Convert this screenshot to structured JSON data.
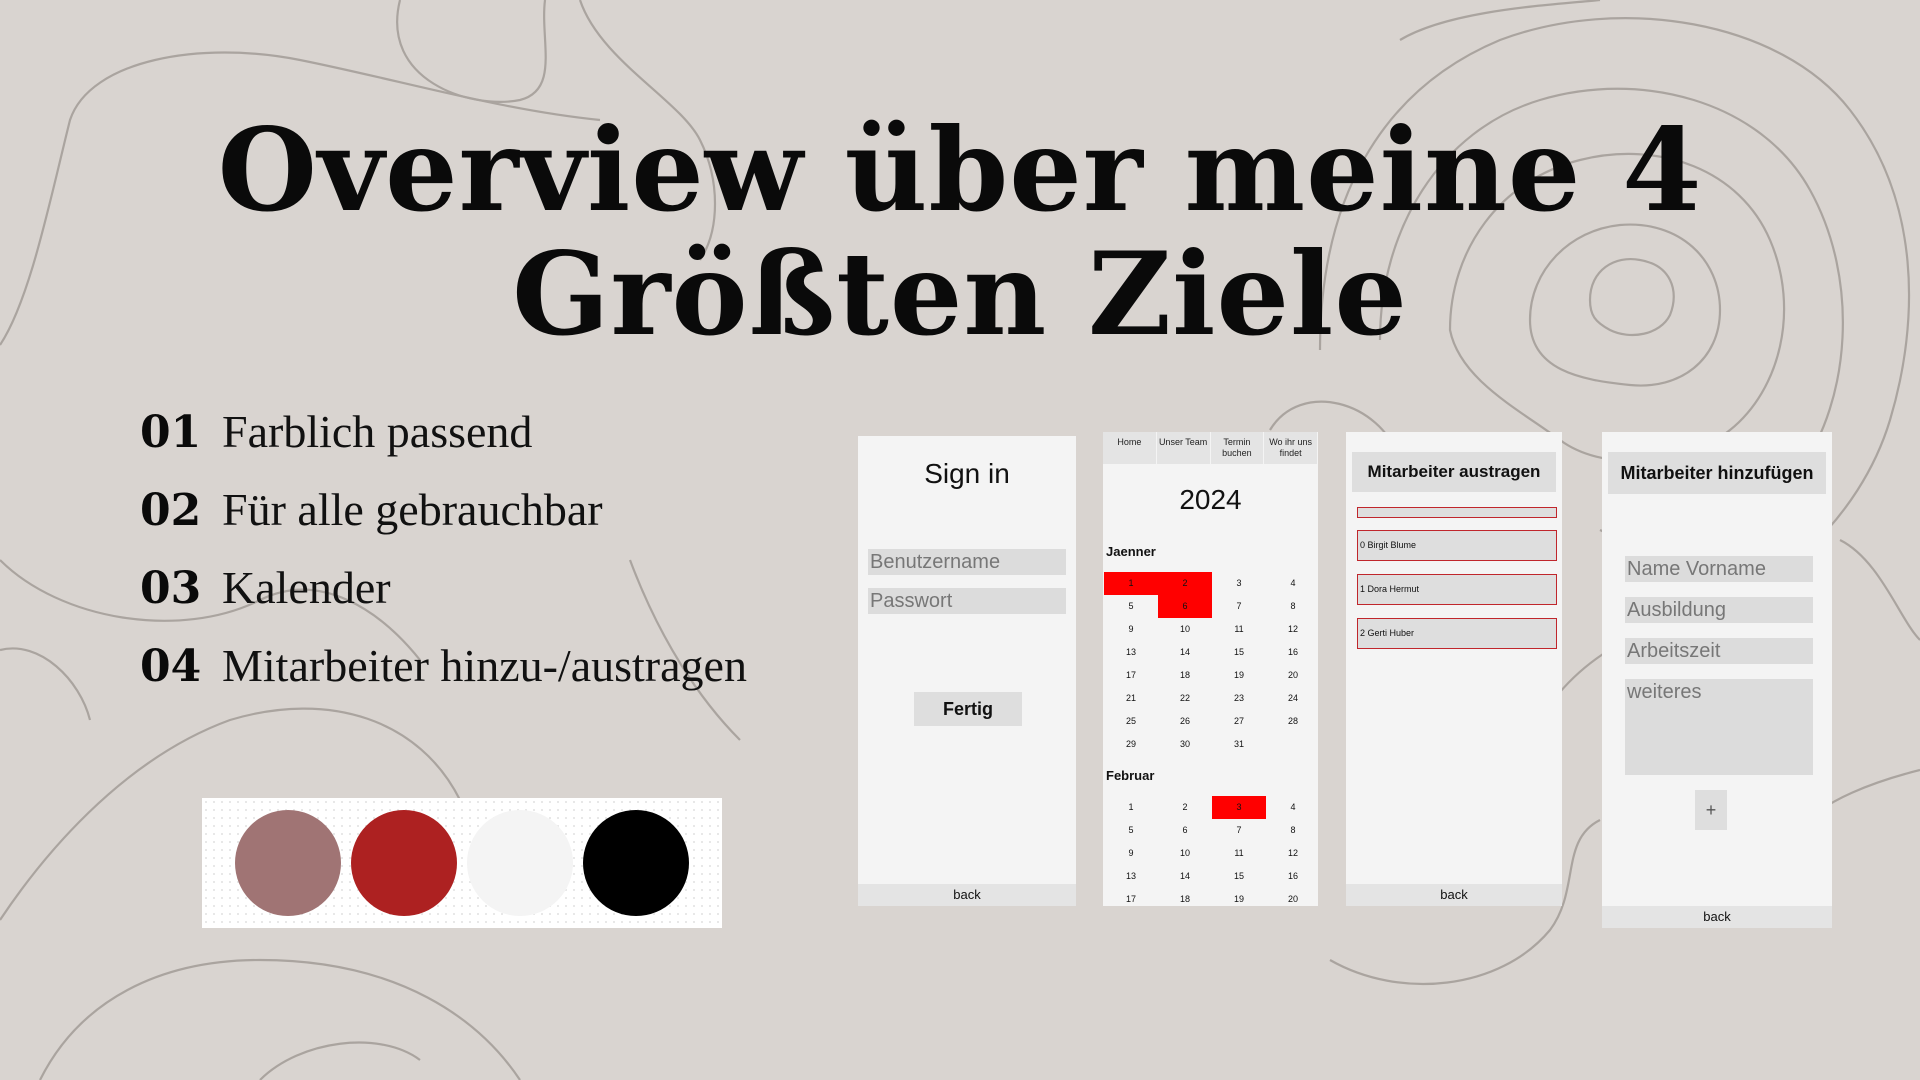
{
  "title": "Overview über meine 4 Größten Ziele",
  "goals": [
    {
      "num": "01",
      "text": "Farblich passend"
    },
    {
      "num": "02",
      "text": "Für alle gebrauchbar"
    },
    {
      "num": "03",
      "text": "Kalender"
    },
    {
      "num": "04",
      "text": "Mitarbeiter hinzu-/austragen"
    }
  ],
  "palette": [
    "#a07474",
    "#ad2121",
    "#f4f4f4",
    "#000000"
  ],
  "signin": {
    "title": "Sign in",
    "username_placeholder": "Benutzername",
    "password_placeholder": "Passwort",
    "submit": "Fertig",
    "back": "back"
  },
  "calendar": {
    "nav": [
      "Home",
      "Unser Team",
      "Termin buchen",
      "Wo ihr uns findet"
    ],
    "year": "2024",
    "months": [
      {
        "name": "Jaenner",
        "days": [
          [
            "1",
            "2",
            "3",
            "4"
          ],
          [
            "5",
            "6",
            "7",
            "8"
          ],
          [
            "9",
            "10",
            "11",
            "12"
          ],
          [
            "13",
            "14",
            "15",
            "16"
          ],
          [
            "17",
            "18",
            "19",
            "20"
          ],
          [
            "21",
            "22",
            "23",
            "24"
          ],
          [
            "25",
            "26",
            "27",
            "28"
          ],
          [
            "29",
            "30",
            "31",
            ""
          ]
        ],
        "highlighted": [
          "1",
          "2",
          "6"
        ]
      },
      {
        "name": "Februar",
        "days": [
          [
            "1",
            "2",
            "3",
            "4"
          ],
          [
            "5",
            "6",
            "7",
            "8"
          ],
          [
            "9",
            "10",
            "11",
            "12"
          ],
          [
            "13",
            "14",
            "15",
            "16"
          ],
          [
            "17",
            "18",
            "19",
            "20"
          ]
        ],
        "highlighted": [
          "3"
        ]
      }
    ]
  },
  "remove": {
    "title": "Mitarbeiter austragen",
    "employees": [
      "0 Birgit Blume",
      "1 Dora Hermut",
      "2 Gerti Huber"
    ],
    "back": "back"
  },
  "add": {
    "title": "Mitarbeiter hinzufügen",
    "fields": [
      "Name Vorname",
      "Ausbildung",
      "Arbeitszeit",
      "weiteres"
    ],
    "plus": "+",
    "back": "back"
  }
}
